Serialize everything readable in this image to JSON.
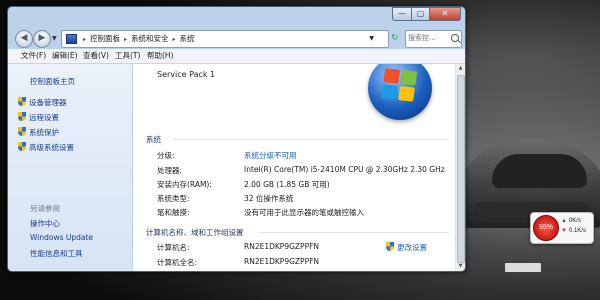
{
  "window": {
    "controls": {
      "minimize": "—",
      "maximize": "▢",
      "close": "✕"
    },
    "breadcrumbs": [
      "控制面板",
      "系统和安全",
      "系统"
    ],
    "search_placeholder": "搜索控...",
    "menu": [
      "文件(F)",
      "编辑(E)",
      "查看(V)",
      "工具(T)",
      "帮助(H)"
    ]
  },
  "sidebar": {
    "home": "控制面板主页",
    "items": [
      {
        "label": "设备管理器",
        "icon": "shield-icon"
      },
      {
        "label": "远程设置",
        "icon": "shield-icon"
      },
      {
        "label": "系统保护",
        "icon": "shield-icon"
      },
      {
        "label": "高级系统设置",
        "icon": "shield-icon"
      }
    ],
    "see_also_title": "另请参阅",
    "see_also": [
      "操作中心",
      "Windows Update",
      "性能信息和工具"
    ]
  },
  "content": {
    "service_pack": "Service Pack 1",
    "system_section": "系统",
    "system_rows": [
      {
        "label": "分级:",
        "value": "系统分级不可用",
        "is_link": true
      },
      {
        "label": "处理器:",
        "value": "Intel(R) Core(TM) i5-2410M CPU @ 2.30GHz   2.30 GHz"
      },
      {
        "label": "安装内存(RAM):",
        "value": "2.00 GB (1.85 GB 可用)"
      },
      {
        "label": "系统类型:",
        "value": "32 位操作系统"
      },
      {
        "label": "笔和触摸:",
        "value": "没有可用于此显示器的笔或触控输入"
      }
    ],
    "computer_section": "计算机名称、域和工作组设置",
    "computer_rows": [
      {
        "label": "计算机名:",
        "value": "RN2E1DKP9GZPPFN"
      },
      {
        "label": "计算机全名:",
        "value": "RN2E1DKP9GZPPFN"
      }
    ],
    "change_settings": "更改设置"
  },
  "gadget": {
    "percent": "95%",
    "upload": "0K/s",
    "download": "0.1K/s",
    "colors": {
      "gauge": "#d3241a"
    }
  },
  "colors": {
    "link": "#1d5fbf",
    "frame": "#bcd2ea"
  }
}
